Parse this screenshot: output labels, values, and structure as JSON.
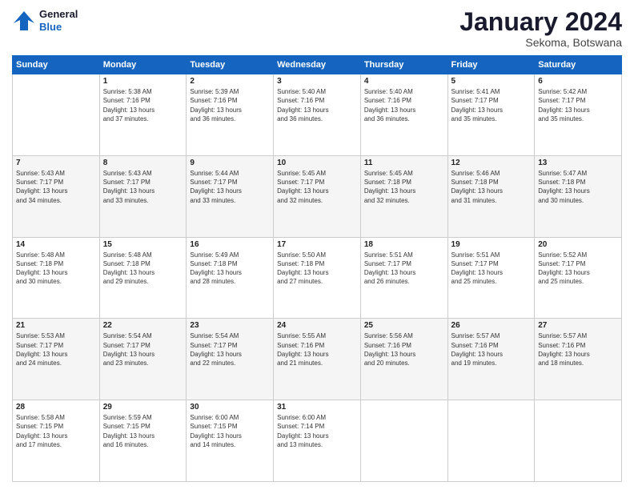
{
  "header": {
    "logo_line1": "General",
    "logo_line2": "Blue",
    "month_title": "January 2024",
    "location": "Sekoma, Botswana"
  },
  "weekdays": [
    "Sunday",
    "Monday",
    "Tuesday",
    "Wednesday",
    "Thursday",
    "Friday",
    "Saturday"
  ],
  "weeks": [
    [
      {
        "day": "",
        "content": ""
      },
      {
        "day": "1",
        "content": "Sunrise: 5:38 AM\nSunset: 7:16 PM\nDaylight: 13 hours\nand 37 minutes."
      },
      {
        "day": "2",
        "content": "Sunrise: 5:39 AM\nSunset: 7:16 PM\nDaylight: 13 hours\nand 36 minutes."
      },
      {
        "day": "3",
        "content": "Sunrise: 5:40 AM\nSunset: 7:16 PM\nDaylight: 13 hours\nand 36 minutes."
      },
      {
        "day": "4",
        "content": "Sunrise: 5:40 AM\nSunset: 7:16 PM\nDaylight: 13 hours\nand 36 minutes."
      },
      {
        "day": "5",
        "content": "Sunrise: 5:41 AM\nSunset: 7:17 PM\nDaylight: 13 hours\nand 35 minutes."
      },
      {
        "day": "6",
        "content": "Sunrise: 5:42 AM\nSunset: 7:17 PM\nDaylight: 13 hours\nand 35 minutes."
      }
    ],
    [
      {
        "day": "7",
        "content": "Sunrise: 5:43 AM\nSunset: 7:17 PM\nDaylight: 13 hours\nand 34 minutes."
      },
      {
        "day": "8",
        "content": "Sunrise: 5:43 AM\nSunset: 7:17 PM\nDaylight: 13 hours\nand 33 minutes."
      },
      {
        "day": "9",
        "content": "Sunrise: 5:44 AM\nSunset: 7:17 PM\nDaylight: 13 hours\nand 33 minutes."
      },
      {
        "day": "10",
        "content": "Sunrise: 5:45 AM\nSunset: 7:17 PM\nDaylight: 13 hours\nand 32 minutes."
      },
      {
        "day": "11",
        "content": "Sunrise: 5:45 AM\nSunset: 7:18 PM\nDaylight: 13 hours\nand 32 minutes."
      },
      {
        "day": "12",
        "content": "Sunrise: 5:46 AM\nSunset: 7:18 PM\nDaylight: 13 hours\nand 31 minutes."
      },
      {
        "day": "13",
        "content": "Sunrise: 5:47 AM\nSunset: 7:18 PM\nDaylight: 13 hours\nand 30 minutes."
      }
    ],
    [
      {
        "day": "14",
        "content": "Sunrise: 5:48 AM\nSunset: 7:18 PM\nDaylight: 13 hours\nand 30 minutes."
      },
      {
        "day": "15",
        "content": "Sunrise: 5:48 AM\nSunset: 7:18 PM\nDaylight: 13 hours\nand 29 minutes."
      },
      {
        "day": "16",
        "content": "Sunrise: 5:49 AM\nSunset: 7:18 PM\nDaylight: 13 hours\nand 28 minutes."
      },
      {
        "day": "17",
        "content": "Sunrise: 5:50 AM\nSunset: 7:18 PM\nDaylight: 13 hours\nand 27 minutes."
      },
      {
        "day": "18",
        "content": "Sunrise: 5:51 AM\nSunset: 7:17 PM\nDaylight: 13 hours\nand 26 minutes."
      },
      {
        "day": "19",
        "content": "Sunrise: 5:51 AM\nSunset: 7:17 PM\nDaylight: 13 hours\nand 25 minutes."
      },
      {
        "day": "20",
        "content": "Sunrise: 5:52 AM\nSunset: 7:17 PM\nDaylight: 13 hours\nand 25 minutes."
      }
    ],
    [
      {
        "day": "21",
        "content": "Sunrise: 5:53 AM\nSunset: 7:17 PM\nDaylight: 13 hours\nand 24 minutes."
      },
      {
        "day": "22",
        "content": "Sunrise: 5:54 AM\nSunset: 7:17 PM\nDaylight: 13 hours\nand 23 minutes."
      },
      {
        "day": "23",
        "content": "Sunrise: 5:54 AM\nSunset: 7:17 PM\nDaylight: 13 hours\nand 22 minutes."
      },
      {
        "day": "24",
        "content": "Sunrise: 5:55 AM\nSunset: 7:16 PM\nDaylight: 13 hours\nand 21 minutes."
      },
      {
        "day": "25",
        "content": "Sunrise: 5:56 AM\nSunset: 7:16 PM\nDaylight: 13 hours\nand 20 minutes."
      },
      {
        "day": "26",
        "content": "Sunrise: 5:57 AM\nSunset: 7:16 PM\nDaylight: 13 hours\nand 19 minutes."
      },
      {
        "day": "27",
        "content": "Sunrise: 5:57 AM\nSunset: 7:16 PM\nDaylight: 13 hours\nand 18 minutes."
      }
    ],
    [
      {
        "day": "28",
        "content": "Sunrise: 5:58 AM\nSunset: 7:15 PM\nDaylight: 13 hours\nand 17 minutes."
      },
      {
        "day": "29",
        "content": "Sunrise: 5:59 AM\nSunset: 7:15 PM\nDaylight: 13 hours\nand 16 minutes."
      },
      {
        "day": "30",
        "content": "Sunrise: 6:00 AM\nSunset: 7:15 PM\nDaylight: 13 hours\nand 14 minutes."
      },
      {
        "day": "31",
        "content": "Sunrise: 6:00 AM\nSunset: 7:14 PM\nDaylight: 13 hours\nand 13 minutes."
      },
      {
        "day": "",
        "content": ""
      },
      {
        "day": "",
        "content": ""
      },
      {
        "day": "",
        "content": ""
      }
    ]
  ]
}
